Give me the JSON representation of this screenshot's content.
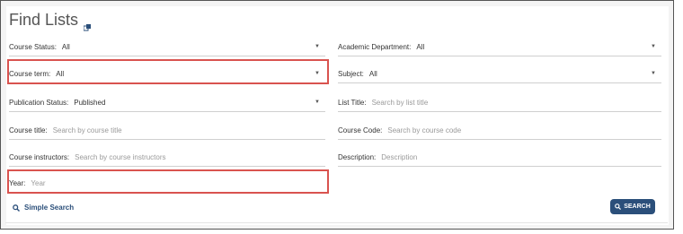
{
  "title": "Find Lists",
  "fields": {
    "course_status": {
      "label": "Course Status:",
      "value": "All"
    },
    "academic_department": {
      "label": "Academic Department:",
      "value": "All"
    },
    "course_term": {
      "label": "Course term:",
      "value": "All"
    },
    "subject": {
      "label": "Subject:",
      "value": "All"
    },
    "publication_status": {
      "label": "Publication Status:",
      "value": "Published"
    },
    "list_title": {
      "label": "List Title:",
      "placeholder": "Search by list title"
    },
    "course_title": {
      "label": "Course title:",
      "placeholder": "Search by course title"
    },
    "course_code": {
      "label": "Course Code:",
      "placeholder": "Search by course code"
    },
    "course_instructors": {
      "label": "Course instructors:",
      "placeholder": "Search by course instructors"
    },
    "description": {
      "label": "Description:",
      "placeholder": "Description"
    },
    "year": {
      "label": "Year:",
      "placeholder": "Year"
    }
  },
  "actions": {
    "simple_search": "Simple Search",
    "search": "SEARCH"
  },
  "colors": {
    "accent": "#2b4f7a",
    "highlight": "#d9534f"
  }
}
